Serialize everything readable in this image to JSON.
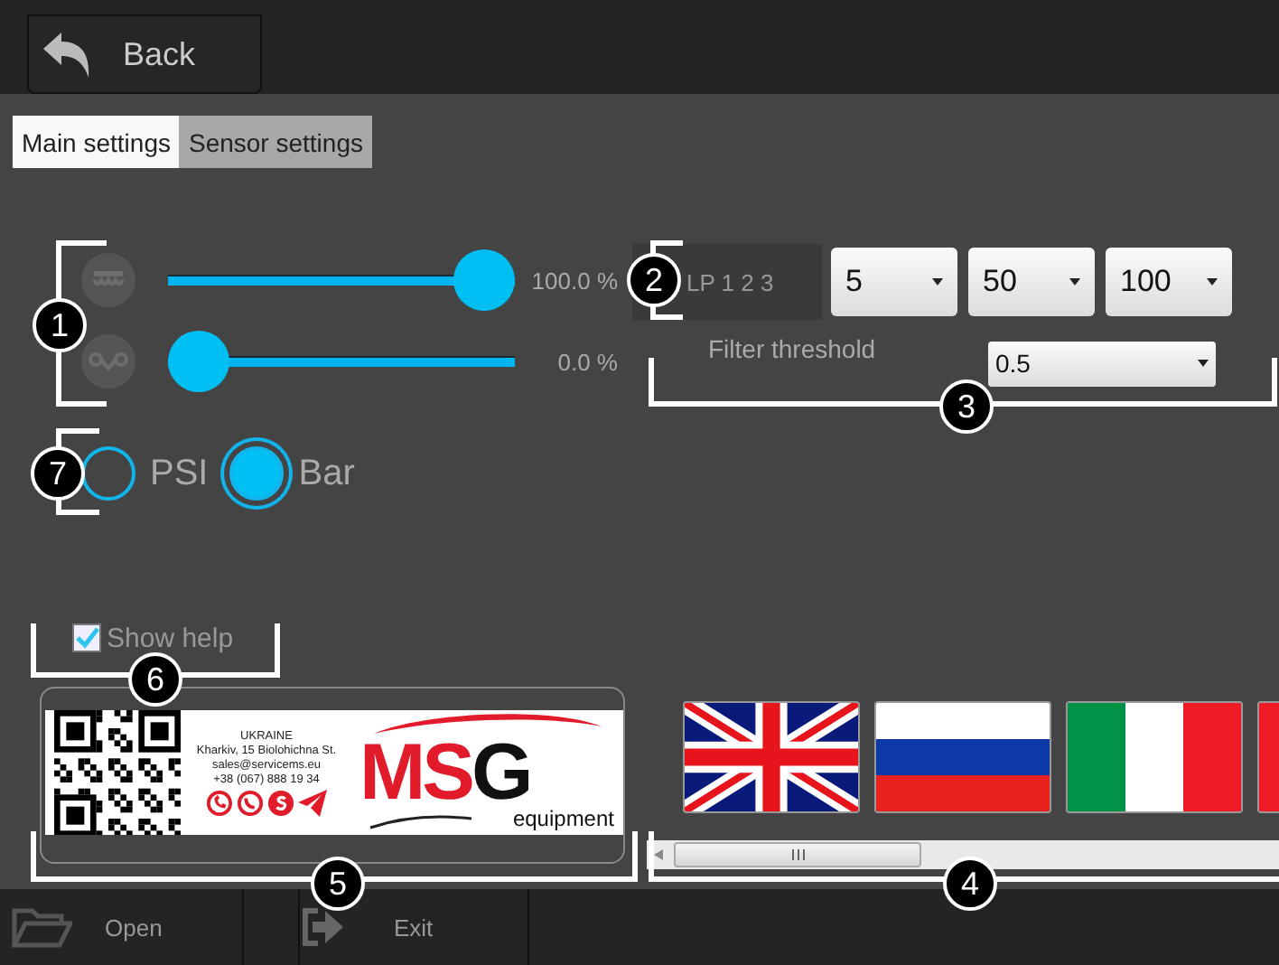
{
  "back_button": {
    "label": "Back"
  },
  "tabs": [
    {
      "label": "Main settings",
      "selected": true
    },
    {
      "label": "Sensor settings",
      "selected": false
    }
  ],
  "sliders": [
    {
      "kind": "brake",
      "level": 1,
      "reading": "100.0 %"
    },
    {
      "kind": "chain",
      "level": 0,
      "reading": "0.0 %"
    }
  ],
  "filter": {
    "label": "LP 1 2 3",
    "values": [
      "5",
      "50",
      "100"
    ],
    "threshold_label": "Filter threshold",
    "threshold_value": "0.5"
  },
  "units": [
    {
      "label": "PSI",
      "selected": false
    },
    {
      "label": "Bar",
      "selected": true
    }
  ],
  "show_help": {
    "label": "Show help",
    "checked": true
  },
  "contact": {
    "country": "UKRAINE",
    "address": "Kharkiv, 15 Biolohichna St.",
    "email": "sales@servicems.eu",
    "phone": "+38 (067) 888 19 34",
    "brand": "MSG",
    "tagline": "equipment"
  },
  "flags": [
    {
      "kind": "uk"
    },
    {
      "kind": "russia"
    },
    {
      "kind": "italy"
    },
    {
      "kind": "red"
    }
  ],
  "callouts": [
    "1",
    "2",
    "3",
    "4",
    "5",
    "6",
    "7"
  ],
  "bottom_bar": [
    {
      "kind": "folder",
      "label": "Open"
    },
    {
      "kind": "exit",
      "label": "Exit"
    }
  ]
}
